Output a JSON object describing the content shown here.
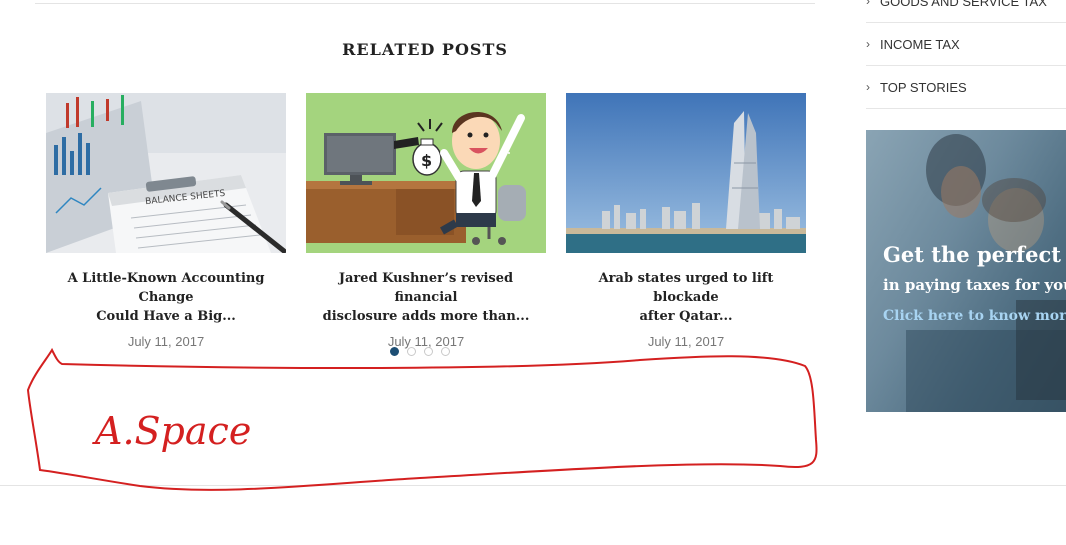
{
  "related": {
    "heading": "RELATED POSTS",
    "posts": [
      {
        "title_line1": "A Little-Known Accounting Change",
        "title_line2": "Could Have a Big...",
        "date": "July 11, 2017",
        "thumb_text": "BALANCE SHEETS"
      },
      {
        "title_line1": "Jared Kushner’s revised financial",
        "title_line2": "disclosure adds more than...",
        "date": "July 11, 2017",
        "thumb_text": "$"
      },
      {
        "title_line1": "Arab states urged to lift blockade",
        "title_line2": "after Qatar...",
        "date": "July 11, 2017"
      }
    ],
    "active_page": 1,
    "page_count": 4
  },
  "sidebar": {
    "categories": [
      "GOODS AND SERVICE TAX",
      "INCOME TAX",
      "TOP STORIES"
    ],
    "ad": {
      "headline": "Get the perfect a",
      "subline": "in paying taxes for you",
      "cta": "Click here to know more"
    }
  },
  "annotation": {
    "handwritten_text": "A.Space",
    "color": "#d42020"
  },
  "colors": {
    "accent": "#1d4e74",
    "date": "#777777",
    "link": "#a8d4f2"
  }
}
